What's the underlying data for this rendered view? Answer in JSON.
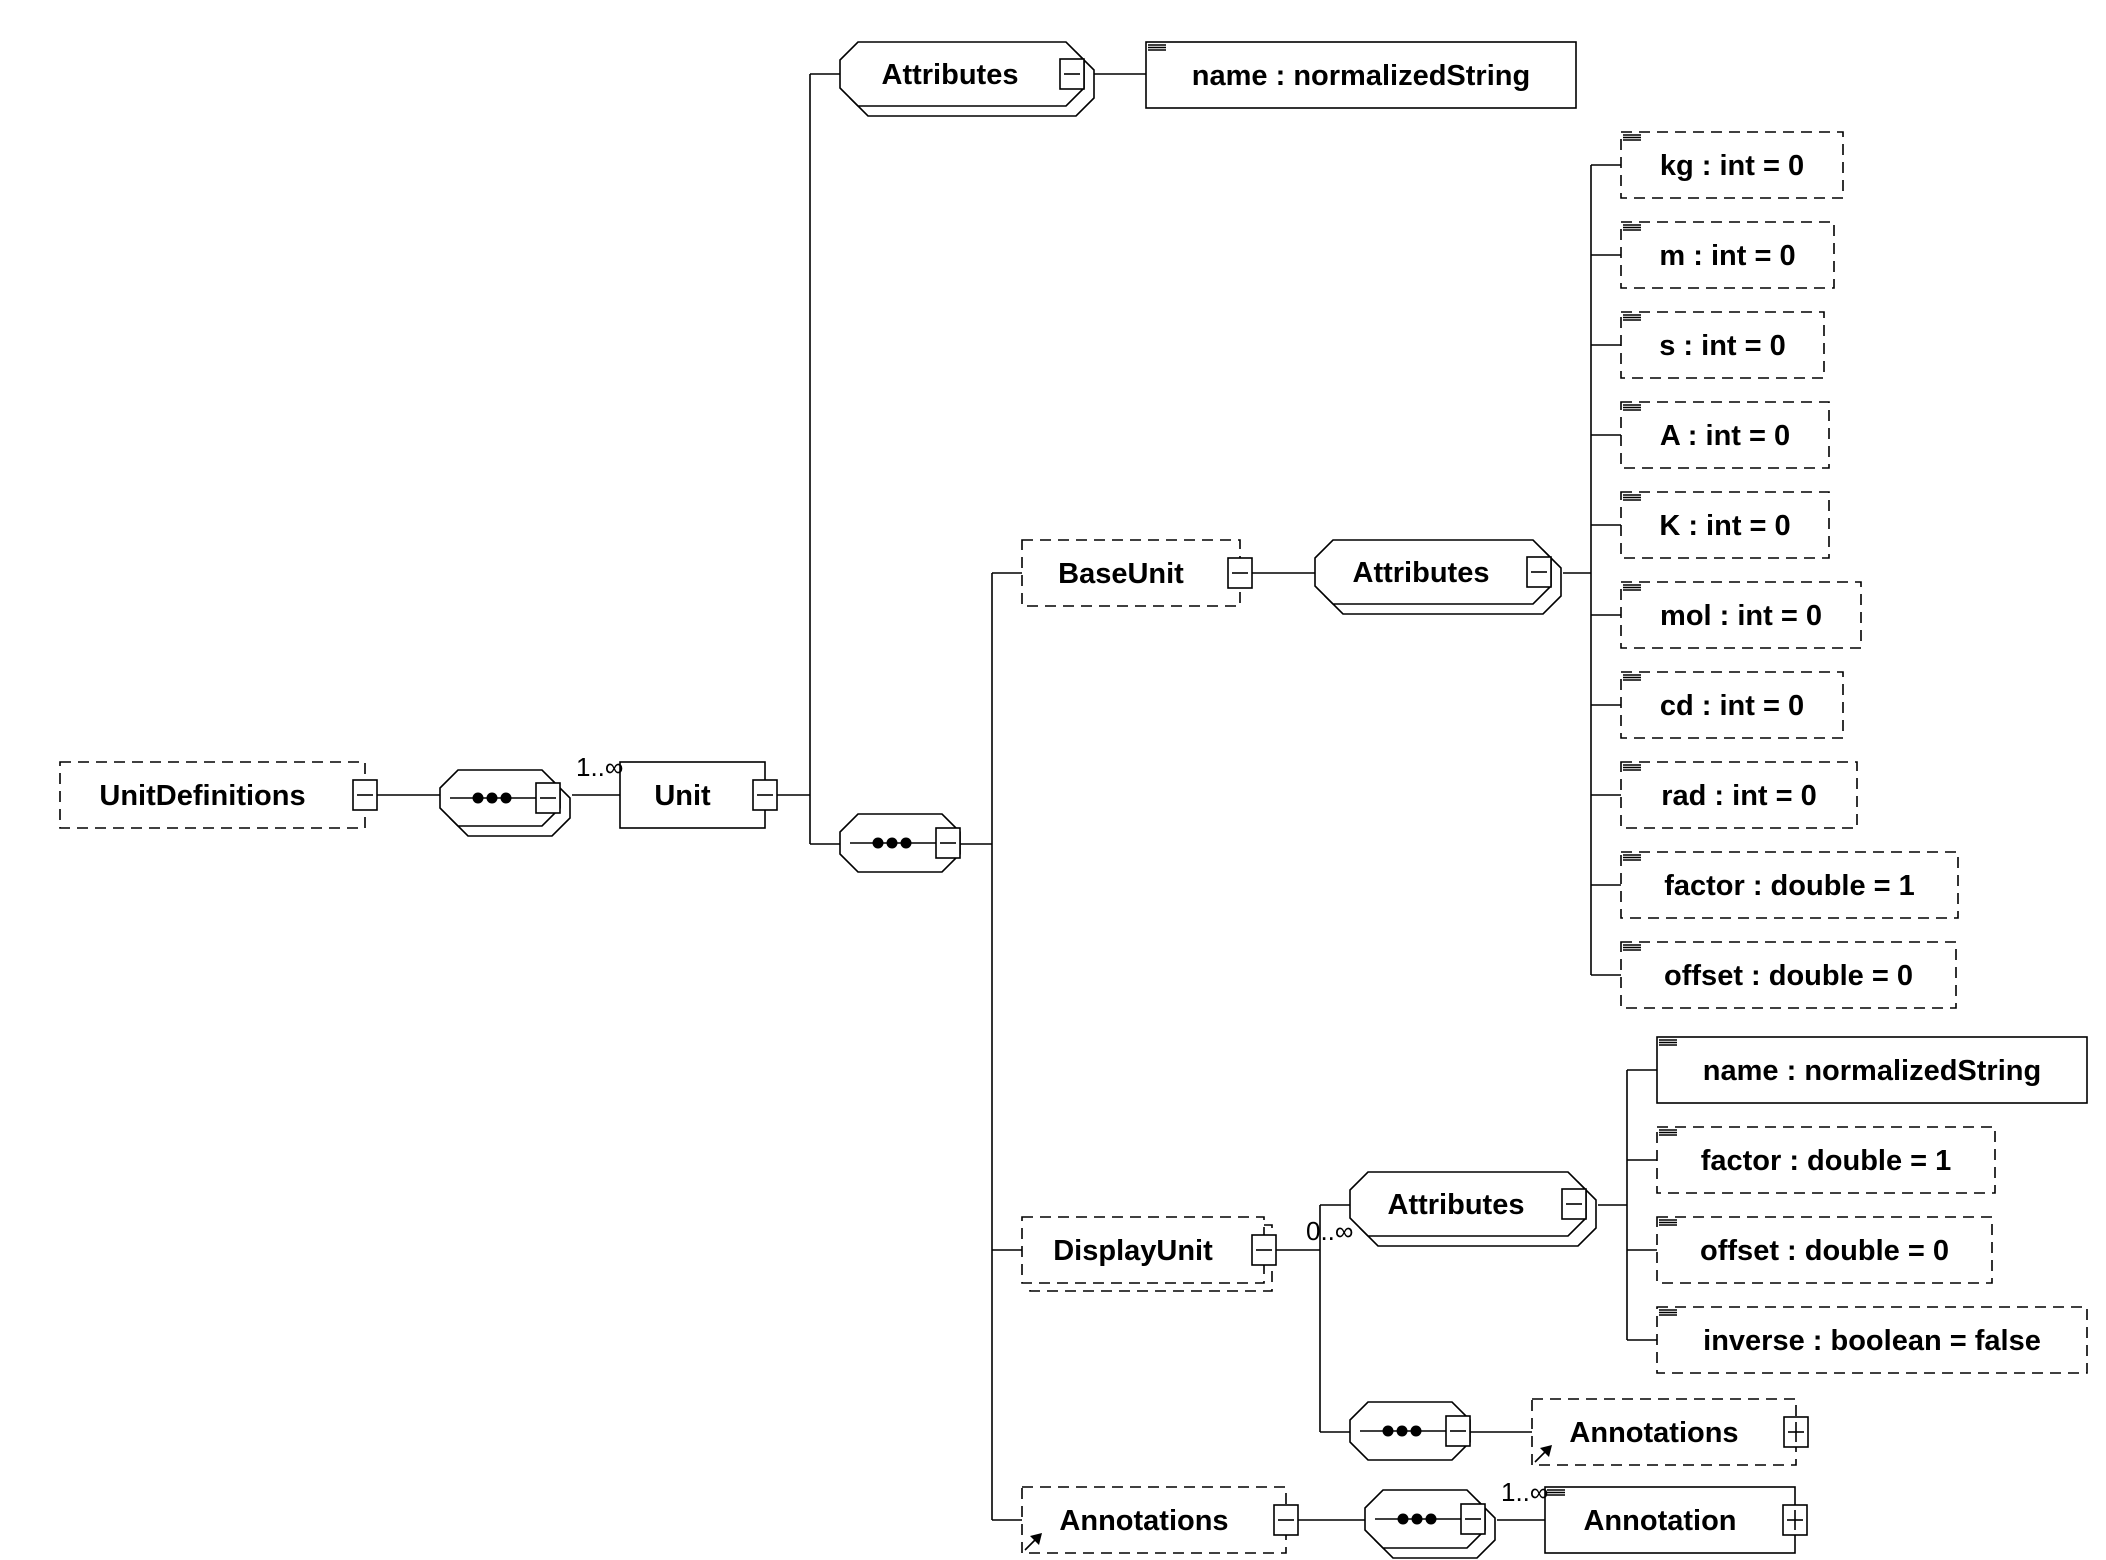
{
  "diagram": {
    "root": {
      "label": "UnitDefinitions",
      "optional": true,
      "toggle": "collapse"
    },
    "root_sequence": {
      "icon": "sequence-icon",
      "toggle": "collapse"
    },
    "unit": {
      "label": "Unit",
      "cardinality": "1..∞",
      "optional": false,
      "toggle": "collapse"
    },
    "unit_attributes": {
      "label": "Attributes",
      "toggle": "collapse",
      "items": [
        {
          "label": "name : normalizedString",
          "optional": false
        }
      ]
    },
    "unit_sequence": {
      "icon": "sequence-icon",
      "toggle": "collapse"
    },
    "base_unit": {
      "label": "BaseUnit",
      "optional": true,
      "toggle": "collapse",
      "attributes_label": "Attributes",
      "attributes": [
        {
          "label": "kg : int = 0",
          "optional": true
        },
        {
          "label": "m : int = 0",
          "optional": true
        },
        {
          "label": "s : int = 0",
          "optional": true
        },
        {
          "label": "A : int = 0",
          "optional": true
        },
        {
          "label": "K : int = 0",
          "optional": true
        },
        {
          "label": "mol : int = 0",
          "optional": true
        },
        {
          "label": "cd : int = 0",
          "optional": true
        },
        {
          "label": "rad : int = 0",
          "optional": true
        },
        {
          "label": "factor : double = 1",
          "optional": true
        },
        {
          "label": "offset : double = 0",
          "optional": true
        }
      ]
    },
    "display_unit": {
      "label": "DisplayUnit",
      "cardinality": "0..∞",
      "optional": true,
      "toggle": "collapse",
      "attributes_label": "Attributes",
      "attributes": [
        {
          "label": "name : normalizedString",
          "optional": false
        },
        {
          "label": "factor : double = 1",
          "optional": true
        },
        {
          "label": "offset : double = 0",
          "optional": true
        },
        {
          "label": "inverse : boolean = false",
          "optional": true
        }
      ],
      "annotations": {
        "label": "Annotations",
        "toggle": "expand",
        "reference": true
      }
    },
    "annotations": {
      "label": "Annotations",
      "optional": true,
      "toggle": "collapse",
      "reference": true,
      "child": {
        "label": "Annotation",
        "cardinality": "1..∞",
        "toggle": "expand"
      }
    }
  }
}
